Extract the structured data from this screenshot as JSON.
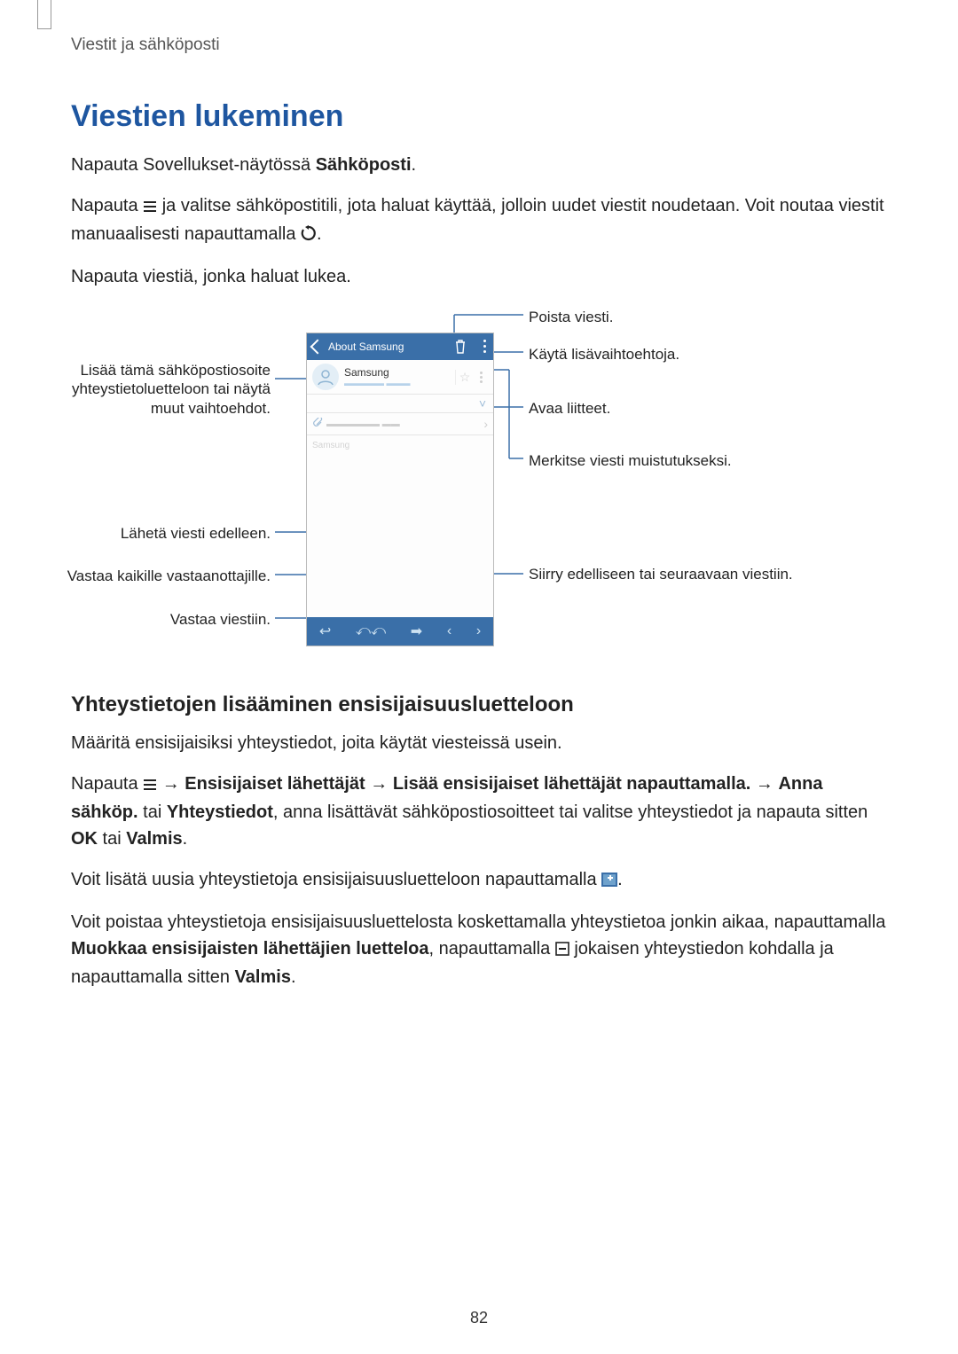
{
  "breadcrumb": "Viestit ja sähköposti",
  "section_title": "Viestien lukeminen",
  "para1_pre": "Napauta Sovellukset-näytössä ",
  "para1_bold": "Sähköposti",
  "para1_post": ".",
  "para2_pre": "Napauta ",
  "para2_mid": " ja valitse sähköpostitili, jota haluat käyttää, jolloin uudet viestit noudetaan. Voit noutaa viestit manuaalisesti napauttamalla ",
  "para2_post": ".",
  "para3": "Napauta viestiä, jonka haluat lukea.",
  "labels": {
    "delete": "Poista viesti.",
    "more_options": "Käytä lisävaihtoehtoja.",
    "open_attachments": "Avaa liitteet.",
    "mark_reminder": "Merkitse viesti muistutukseksi.",
    "prev_next": "Siirry edelliseen tai seuraavaan viestiin.",
    "add_contact": "Lisää tämä sähköpostiosoite yhteystietoluetteloon tai näytä muut vaihtoehdot.",
    "forward": "Lähetä viesti edelleen.",
    "reply_all": "Vastaa kaikille vastaanottajille.",
    "reply": "Vastaa viestiin."
  },
  "phone": {
    "header": "About Samsung",
    "sender": "Samsung",
    "body_word": "Samsung"
  },
  "subsection_title": "Yhteystietojen lisääminen ensisijaisuusluetteloon",
  "sub_p1": "Määritä ensisijaisiksi yhteystiedot, joita käytät viesteissä usein.",
  "sub_p2_pre": "Napauta ",
  "arrow": "→",
  "sub_p2_b1": "Ensisijaiset lähettäjät",
  "sub_p2_b2": "Lisää ensisijaiset lähettäjät napauttamalla.",
  "sub_p2_b3": "Anna sähköp.",
  "sub_p2_mid1": " tai ",
  "sub_p2_b4": "Yhteystiedot",
  "sub_p2_mid2": ", anna lisättävät sähköpostiosoitteet tai valitse yhteystiedot ja napauta sitten ",
  "sub_p2_b5": "OK",
  "sub_p2_mid3": " tai ",
  "sub_p2_b6": "Valmis",
  "sub_p2_end": ".",
  "sub_p3_pre": "Voit lisätä uusia yhteystietoja ensisijaisuusluetteloon napauttamalla ",
  "sub_p3_post": ".",
  "sub_p4_a": "Voit poistaa yhteystietoja ensisijaisuusluettelosta koskettamalla yhteystietoa jonkin aikaa, napauttamalla ",
  "sub_p4_b1": "Muokkaa ensisijaisten lähettäjien luetteloa",
  "sub_p4_b": ", napauttamalla ",
  "sub_p4_c": " jokaisen yhteystiedon kohdalla ja napauttamalla sitten ",
  "sub_p4_b2": "Valmis",
  "sub_p4_end": ".",
  "page_number": "82"
}
